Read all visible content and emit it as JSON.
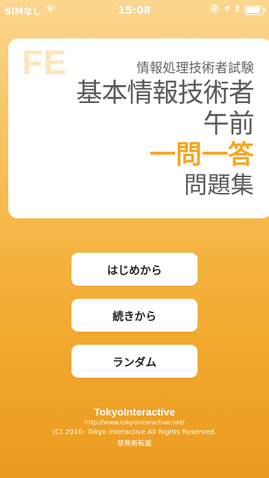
{
  "status_bar": {
    "carrier": "SIMなし",
    "time": "15:08"
  },
  "title_card": {
    "logo": "FE",
    "subtitle": "情報処理技術者試験",
    "title_line1": "基本情報技術者",
    "title_line2": "午前",
    "highlight": "一問一答",
    "collection": "問題集"
  },
  "menu": {
    "start_label": "はじめから",
    "continue_label": "続きから",
    "random_label": "ランダム"
  },
  "footer": {
    "company": "TokyoInteractive",
    "url": "http://www.tokyointeractive.net/",
    "copyright": "(C) 2010- Tokyo Interactive All Rights Reserved.",
    "notice": "禁無断転載"
  }
}
